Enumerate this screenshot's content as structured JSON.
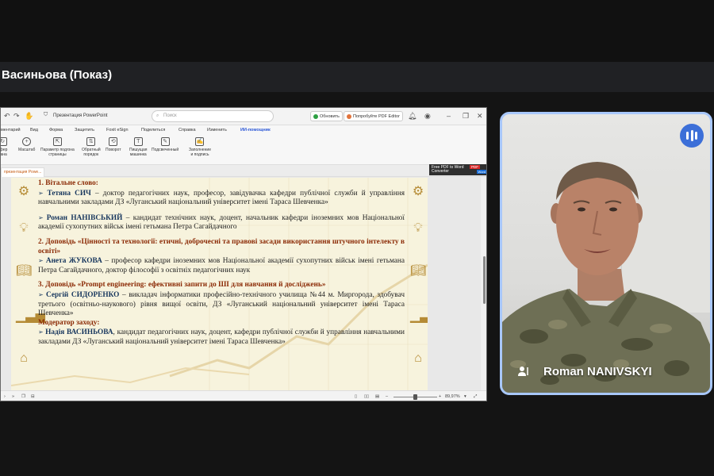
{
  "meeting": {
    "presentation_title": "Васиньова (Показ)"
  },
  "window": {
    "app_title": "Презентация PowerPoint",
    "search_placeholder": "Поиск",
    "update_label": "Обновить",
    "try_pdf_label": "Попробуйте PDF Editor"
  },
  "menu": {
    "items": [
      "ментарий",
      "Вид",
      "Форма",
      "Защитить",
      "Foxit eSign",
      "Поделиться",
      "Справка",
      "Изменить",
      "ИИ-помощник"
    ]
  },
  "ribbon": {
    "tools": [
      {
        "label": "офер\nиана",
        "icon": "convert-icon"
      },
      {
        "label": "Масштаб",
        "icon": "zoom-icon"
      },
      {
        "label": "Параметр подгона\nстраницы",
        "icon": "fit-page-icon"
      },
      {
        "label": "Обратный\nпорядок",
        "icon": "reverse-order-icon"
      },
      {
        "label": "Поворот",
        "icon": "rotate-icon"
      },
      {
        "label": "Пишущая\nмашинка",
        "icon": "typewriter-icon"
      },
      {
        "label": "Подсвеченный",
        "icon": "highlight-icon"
      },
      {
        "label": "Заполнение\nи подпись",
        "icon": "fill-sign-icon"
      }
    ]
  },
  "doc_tab": "презентация Powe...",
  "pdf_badge": {
    "line1": "Free PDF to Word",
    "line2": "Converter",
    "tag": "PDF",
    "sub": "Word"
  },
  "slide": {
    "heading1": "1. Вітальне слово:",
    "p1_name": "Тетяна СИЧ",
    "p1_text": " – доктор педагогічних наук, професор, завідувачка кафедри публічної служби й управління навчальними закладами ДЗ «Луганський національний університет імені Тараса Шевченка»",
    "p2_name": "Роман НАНІВСЬКИЙ",
    "p2_text": " – кандидат технічних наук, доцент, начальник кафедри іноземних мов Національної академії сухопутних військ імені гетьмана Петра Сагайдачного",
    "heading2": "2. Доповідь «Цінності та технології: етичні, доброчесні та правові засади використання штучного інтелекту в освіті»",
    "p3_name": "Анета ЖУКОВА",
    "p3_text": " – професор кафедри іноземних мов Національної академії сухопутних військ імені гетьмана Петра Сагайдачного, доктор філософії з освітніх педагогічних наук",
    "heading3": "3. Доповідь «Prompt engineering: ефективні запити до ШІ для навчання й досліджень»",
    "p4_name": "Сергій СИДОРЕНКО",
    "p4_text": " – викладач інформатики професійно-технічного училища №44 м. Миргорода, здобувач третього (освітньо-наукового) рівня вищої освіти, ДЗ «Луганський національний університет імені Тараса Шевченка»",
    "heading4": "Модератор заходу:",
    "p5_name": "Надія ВАСИНЬОВА",
    "p5_text": ", кандидат педагогічних наук, доцент, кафедри публічної служби й управління навчальними закладами ДЗ «Луганський національний університет імені Тараса Шевченка»"
  },
  "status": {
    "zoom": "89,97%"
  },
  "participant": {
    "name": "Roman NANIVSKYI"
  },
  "colors": {
    "accent_blue": "#a8c7fa",
    "speaking_blue": "#3c6fd8",
    "heading_red": "#8b2a05"
  }
}
